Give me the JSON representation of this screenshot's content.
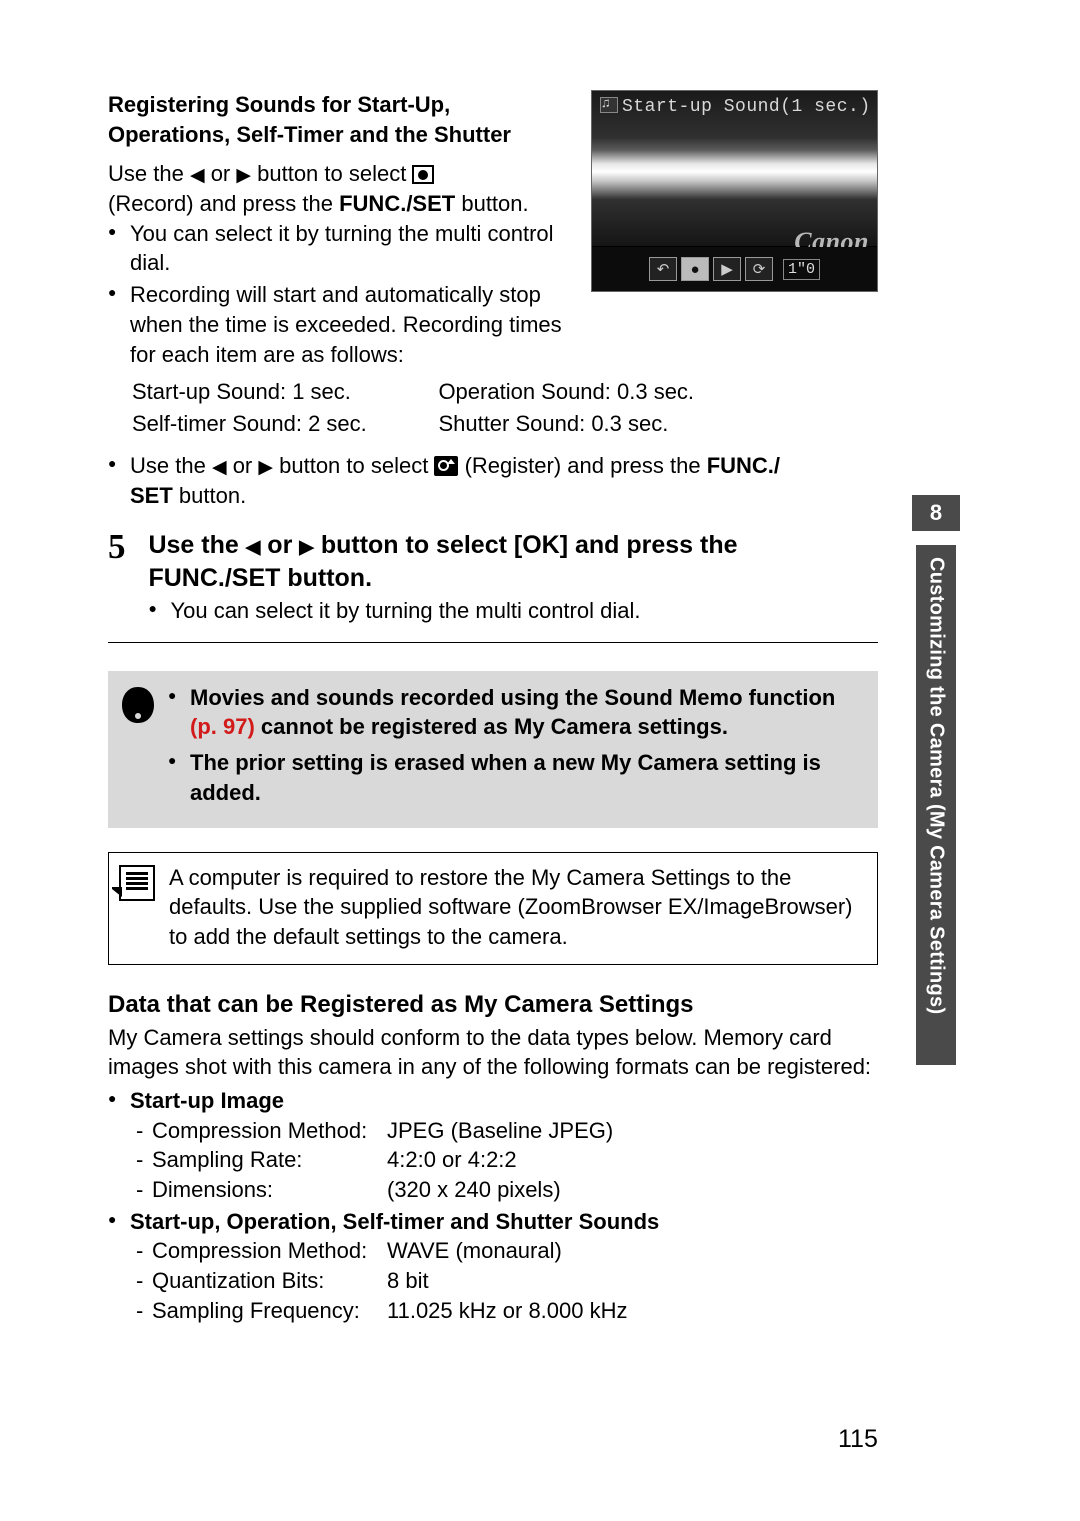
{
  "chapter": {
    "num": "8",
    "title": "Customizing the Camera (My Camera Settings)"
  },
  "screenshot": {
    "header": "Start-up Sound(1 sec.)",
    "brand": "Canon",
    "time": "1\"0"
  },
  "intro": {
    "heading": "Registering Sounds for Start-Up, Operations, Self-Timer and the Shutter",
    "use_the": "Use the ",
    "or": " or ",
    "button_to_select": " button to select ",
    "record_and_press": "(Record) and press the ",
    "func_set": "FUNC./SET",
    "button_dot": " button.",
    "bullet_turn_dial": "You can select it by turning the multi control dial.",
    "bullet_record_start": "Recording will start and automatically stop when the time is exceeded. Recording times for each item are as follows:"
  },
  "sound_table": {
    "r1c1": "Start-up Sound: 1 sec.",
    "r1c2": "Operation Sound: 0.3 sec.",
    "r2c1": "Self-timer Sound: 2 sec.",
    "r2c2": "Shutter Sound: 0.3 sec."
  },
  "register_line": {
    "prefix": "Use the ",
    "mid": " button to select ",
    "register_label": " (Register) and press the ",
    "func_set_a": "FUNC./",
    "func_set_b": "SET",
    "suffix": " button."
  },
  "step5": {
    "num": "5",
    "title_a": "Use the ",
    "title_b": " or ",
    "title_c": " button to select [OK] and press the FUNC./SET button.",
    "bullet": "You can select it by turning the multi control dial."
  },
  "note": {
    "line1_a": "Movies and sounds recorded using the Sound Memo function ",
    "page_ref": "(p. 97)",
    "line1_b": " cannot be registered as My Camera settings.",
    "line2": "The prior setting is erased when a new My Camera setting is added."
  },
  "info": {
    "text": "A computer is required to restore the My Camera Settings to the defaults. Use the supplied software (ZoomBrowser EX/ImageBrowser) to add the default settings to the camera."
  },
  "data_section": {
    "heading": "Data that can be Registered as My Camera Settings",
    "intro": "My Camera settings should conform to the data types below. Memory card images shot with this camera in any of the following formats can be registered:",
    "startup_image_heading": "Start-up Image",
    "img_rows": {
      "r1l": "Compression Method:",
      "r1v": "JPEG (Baseline JPEG)",
      "r2l": "Sampling Rate:",
      "r2v": "4:2:0 or 4:2:2",
      "r3l": "Dimensions:",
      "r3v": "(320 x 240 pixels)"
    },
    "sound_heading": "Start-up, Operation, Self-timer and Shutter Sounds",
    "snd_rows": {
      "r1l": "Compression Method:",
      "r1v": "WAVE (monaural)",
      "r2l": "Quantization Bits:",
      "r2v": "8 bit",
      "r3l": "Sampling Frequency:",
      "r3v": "11.025 kHz or 8.000 kHz"
    }
  },
  "page_num": "115"
}
